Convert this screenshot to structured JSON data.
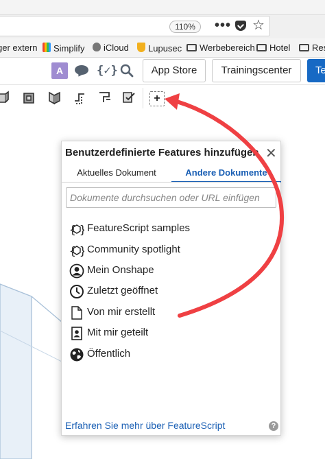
{
  "browser": {
    "zoom": "110%",
    "ellipsis": "•••"
  },
  "bookmarks": [
    {
      "label": "ger extern",
      "icon": "folder-icon"
    },
    {
      "label": "Simplify",
      "icon": "simplify-icon"
    },
    {
      "label": "iCloud",
      "icon": "apple-icon"
    },
    {
      "label": "Lupusec",
      "icon": "shield-icon"
    },
    {
      "label": "Werbebereich",
      "icon": "folder-icon"
    },
    {
      "label": "Hotel",
      "icon": "folder-icon"
    },
    {
      "label": "Res",
      "icon": "folder-icon"
    }
  ],
  "header": {
    "avatar_letter": "A",
    "featurescript_icon": "{✓}",
    "app_store": "App Store",
    "training_center": "Trainingscenter",
    "te_button": "Te"
  },
  "toolbar": {
    "add_custom_symbol": "+"
  },
  "dialog": {
    "title": "Benutzerdefinierte Features hinzufügen",
    "close": "✕",
    "tabs": {
      "current": "Aktuelles Dokument",
      "other": "Andere Dokumente"
    },
    "search_placeholder": "Dokumente durchsuchen oder URL einfügen",
    "items": [
      {
        "label": "FeatureScript samples",
        "icon": "featurescript-samples-icon"
      },
      {
        "label": "Community spotlight",
        "icon": "community-spotlight-icon"
      },
      {
        "label": "Mein Onshape",
        "icon": "person-icon"
      },
      {
        "label": "Zuletzt geöffnet",
        "icon": "clock-icon"
      },
      {
        "label": "Von mir erstellt",
        "icon": "document-icon"
      },
      {
        "label": "Mit mir geteilt",
        "icon": "shared-document-icon"
      },
      {
        "label": "Öffentlich",
        "icon": "globe-icon"
      }
    ],
    "footer_link": "Erfahren Sie mehr über FeatureScript",
    "help": "?"
  },
  "colors": {
    "accent_blue": "#1a5fb4",
    "arrow_red": "#ef4043",
    "avatar_purple": "#9f8cd1"
  }
}
